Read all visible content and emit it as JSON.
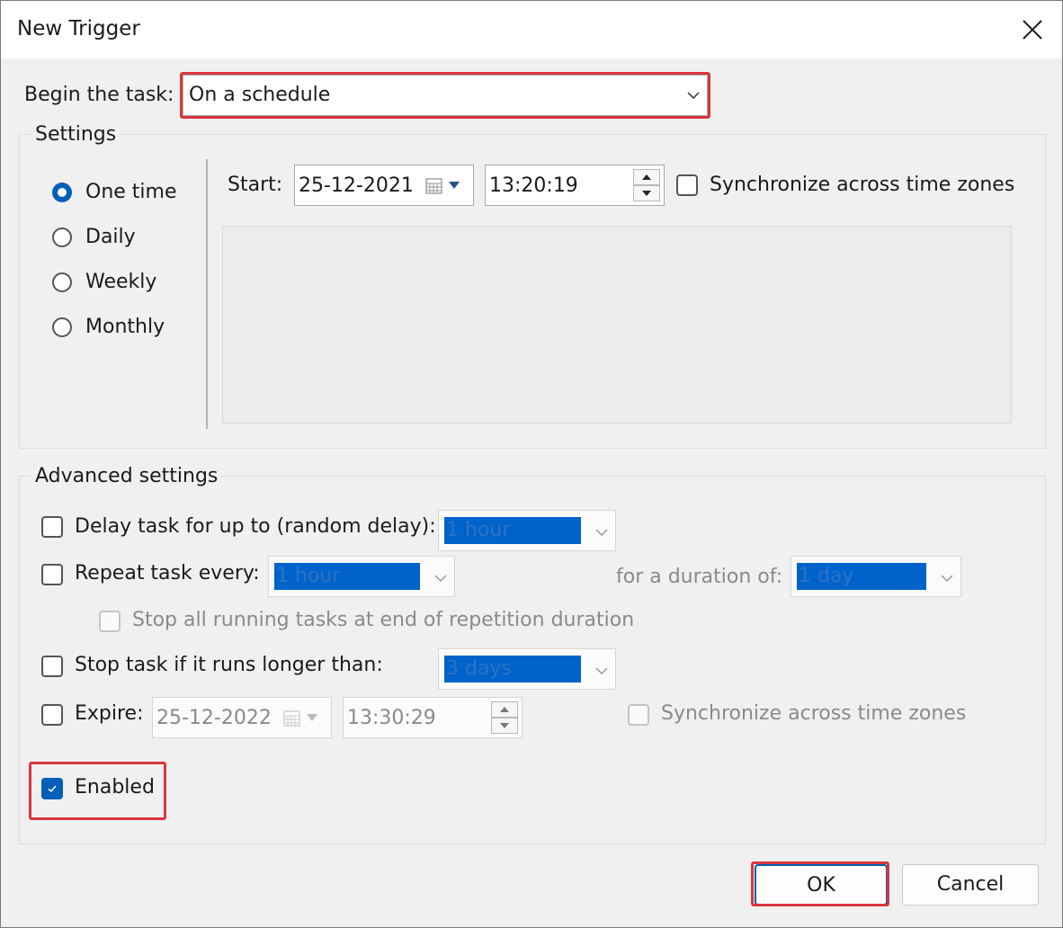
{
  "window": {
    "title": "New Trigger"
  },
  "begin": {
    "label": "Begin the task:",
    "value": "On a schedule"
  },
  "settings": {
    "title": "Settings",
    "radios": [
      {
        "label": "One time",
        "checked": true
      },
      {
        "label": "Daily",
        "checked": false
      },
      {
        "label": "Weekly",
        "checked": false
      },
      {
        "label": "Monthly",
        "checked": false
      }
    ],
    "start_label": "Start:",
    "start_date": "25-12-2021",
    "start_time": "13:20:19",
    "sync_label": "Synchronize across time zones"
  },
  "advanced": {
    "title": "Advanced settings",
    "delay_label": "Delay task for up to (random delay):",
    "delay_value": "1 hour",
    "repeat_label": "Repeat task every:",
    "repeat_value": "1 hour",
    "duration_label": "for a duration of:",
    "duration_value": "1 day",
    "stop_all_label": "Stop all running tasks at end of repetition duration",
    "stop_label": "Stop task if it runs longer than:",
    "stop_value": "3 days",
    "expire_label": "Expire:",
    "expire_date": "25-12-2022",
    "expire_time": "13:30:29",
    "expire_sync_label": "Synchronize across time zones",
    "enabled_label": "Enabled"
  },
  "buttons": {
    "ok": "OK",
    "cancel": "Cancel"
  },
  "colors": {
    "accent": "#005fb8",
    "highlight": "#d9363e",
    "selection": "#0063cc"
  }
}
